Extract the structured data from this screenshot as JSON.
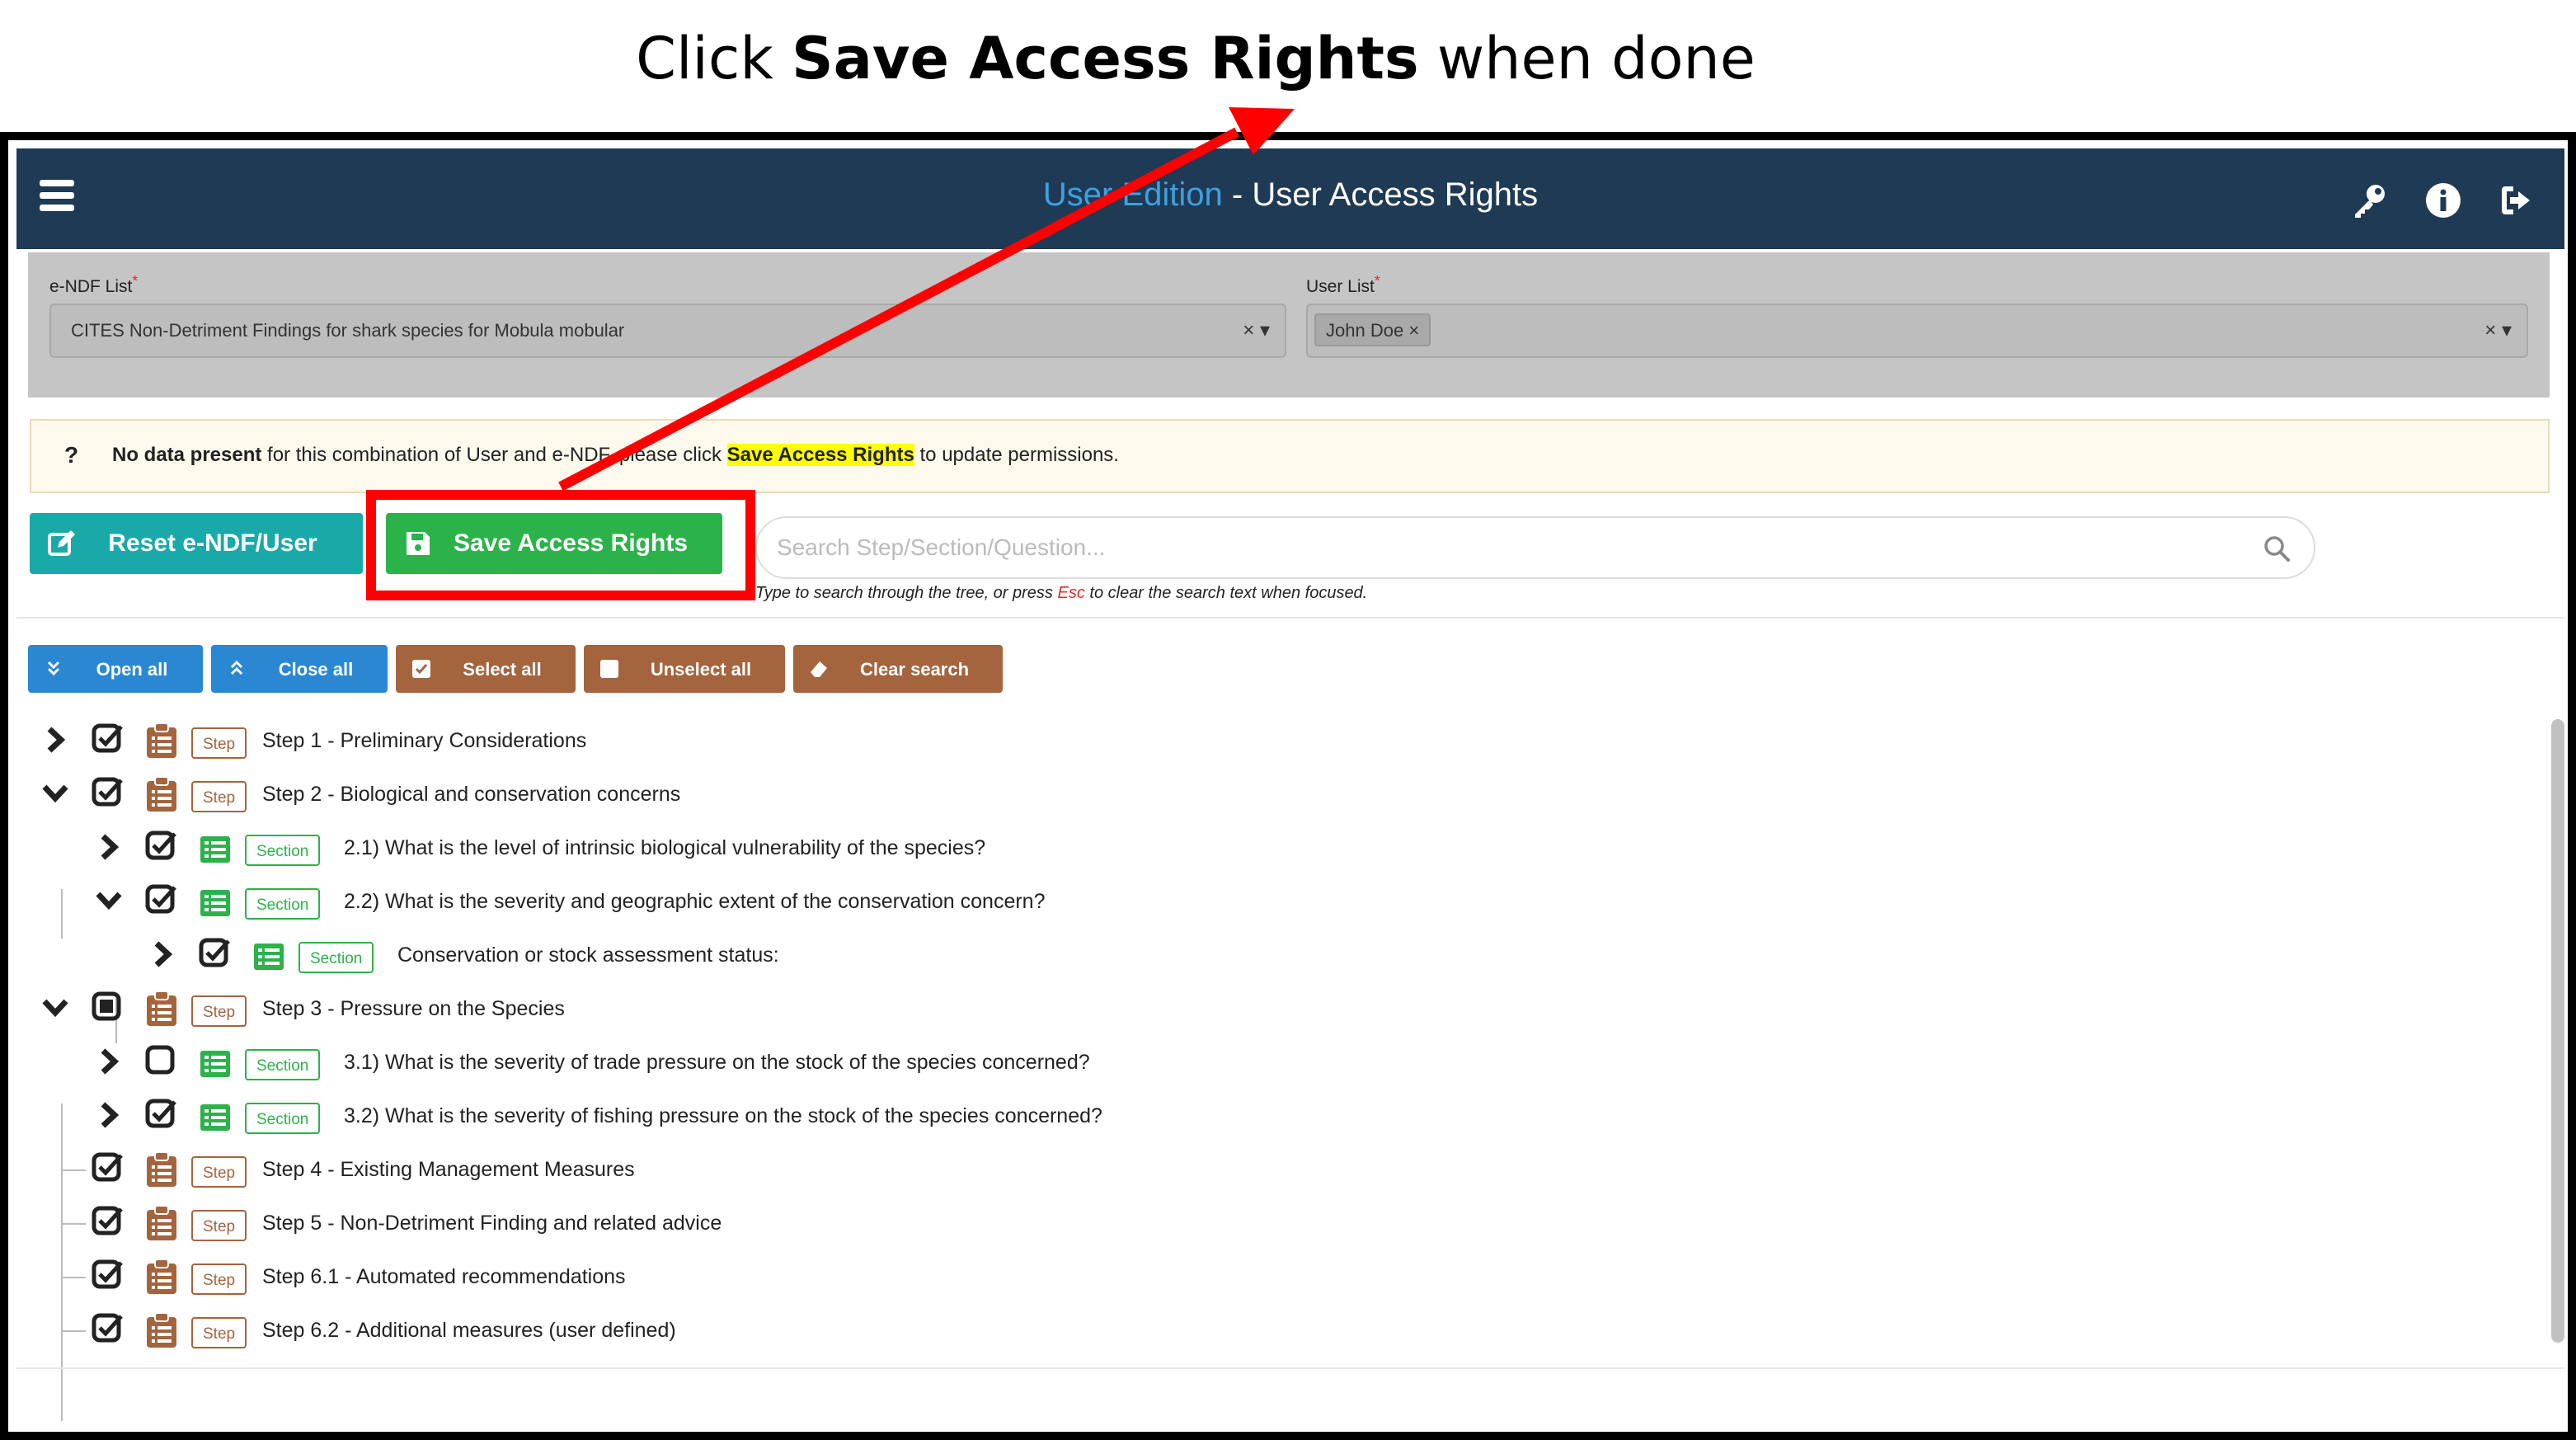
{
  "caption": {
    "prefix": "Click",
    "bold": "Save Access Rights",
    "suffix": "when done"
  },
  "topbar": {
    "title_part1": "User Edition",
    "title_part2": " - User Access Rights",
    "icons": [
      "menu-icon",
      "key-icon",
      "info-icon",
      "logout-icon"
    ]
  },
  "filters": {
    "endf_label": "e-NDF List",
    "endf_value": "CITES Non-Detriment Findings for shark species for Mobula mobular",
    "endf_clear": "×",
    "endf_caret": "▾",
    "user_label": "User List",
    "user_chip": "John Doe",
    "user_chip_remove": "×",
    "user_clear": "×",
    "user_caret": "▾",
    "required_mark": "*"
  },
  "notice": {
    "icon": "?",
    "bold": "No data present",
    "text1": " for this combination of User and e-NDF, please click ",
    "highlight": "Save Access Rights",
    "text2": " to update permissions."
  },
  "actions": {
    "reset_label": "Reset e-NDF/User",
    "save_label": "Save Access Rights"
  },
  "search": {
    "placeholder": "Search Step/Section/Question...",
    "hint_prefix": "Type to search through the tree, or press ",
    "hint_key": "Esc",
    "hint_suffix": " to clear the search text when focused."
  },
  "tools": {
    "open_all": "Open all",
    "close_all": "Close all",
    "select_all": "Select all",
    "unselect_all": "Unselect all",
    "clear_search": "Clear search"
  },
  "colors": {
    "topbar": "#1e3a55",
    "accent_blue": "#3fa0e0",
    "save_green": "#2cb24a",
    "reset_teal": "#1aa9a9",
    "tool_blue": "#2a88d2",
    "tool_brown": "#a4643e",
    "annotation_red": "#ff0000"
  },
  "tree": [
    {
      "level": 0,
      "expand": "collapsed",
      "check": "checked",
      "kind": "Step",
      "label": "Step 1 - Preliminary Considerations"
    },
    {
      "level": 0,
      "expand": "expanded",
      "check": "checked",
      "kind": "Step",
      "label": "Step 2 - Biological and conservation concerns"
    },
    {
      "level": 1,
      "expand": "collapsed",
      "check": "checked",
      "kind": "Section",
      "label": "2.1) What is the level of intrinsic biological vulnerability of the species?"
    },
    {
      "level": 1,
      "expand": "expanded",
      "check": "checked",
      "kind": "Section",
      "label": "2.2) What is the severity and geographic extent of the conservation concern?"
    },
    {
      "level": 2,
      "expand": "collapsed",
      "check": "checked",
      "kind": "Section",
      "label": "Conservation or stock assessment status:"
    },
    {
      "level": 0,
      "expand": "expanded",
      "check": "partial",
      "kind": "Step",
      "label": "Step 3 - Pressure on the Species"
    },
    {
      "level": 1,
      "expand": "collapsed",
      "check": "unchecked",
      "kind": "Section",
      "label": "3.1) What is the severity of trade pressure on the stock of the species concerned?"
    },
    {
      "level": 1,
      "expand": "collapsed",
      "check": "checked",
      "kind": "Section",
      "label": "3.2) What is the severity of fishing pressure on the stock of the species concerned?"
    },
    {
      "level": 0,
      "expand": "leaf",
      "check": "checked",
      "kind": "Step",
      "label": "Step 4 - Existing Management Measures"
    },
    {
      "level": 0,
      "expand": "leaf",
      "check": "checked",
      "kind": "Step",
      "label": "Step 5 - Non-Detriment Finding and related advice"
    },
    {
      "level": 0,
      "expand": "leaf",
      "check": "checked",
      "kind": "Step",
      "label": "Step 6.1 - Automated recommendations"
    },
    {
      "level": 0,
      "expand": "leaf",
      "check": "checked",
      "kind": "Step",
      "label": "Step 6.2 - Additional measures (user defined)"
    }
  ]
}
